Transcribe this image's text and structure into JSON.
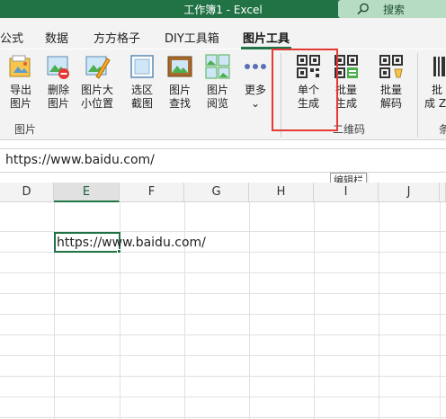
{
  "titlebar": {
    "title": "工作簿1  -  Excel",
    "search_label": "搜索"
  },
  "tabs": [
    {
      "label": "公式"
    },
    {
      "label": "数据"
    },
    {
      "label": "方方格子"
    },
    {
      "label": "DIY工具箱"
    },
    {
      "label": "图片工具",
      "active": true
    }
  ],
  "ribbon": {
    "picture_group": {
      "label": "图片",
      "buttons": [
        {
          "line1": "导出",
          "line2": "图片"
        },
        {
          "line1": "删除",
          "line2": "图片"
        },
        {
          "line1": "图片大",
          "line2": "小位置"
        },
        {
          "line1": "选区",
          "line2": "截图"
        },
        {
          "line1": "图片",
          "line2": "查找"
        },
        {
          "line1": "图片",
          "line2": "阅览"
        },
        {
          "line1": "更多",
          "line2": "⌄"
        }
      ]
    },
    "qr_group": {
      "label": "二维码",
      "buttons": [
        {
          "line1": "单个",
          "line2": "生成"
        },
        {
          "line1": "批量",
          "line2": "生成"
        },
        {
          "line1": "批量",
          "line2": "解码"
        }
      ]
    },
    "next_group": {
      "line1": "批",
      "line2": "成 Z",
      "label": "条"
    }
  },
  "formula_bar": {
    "value": "https://www.baidu.com/"
  },
  "tooltip": "编辑栏",
  "columns": [
    "D",
    "E",
    "F",
    "G",
    "H",
    "I",
    "J"
  ],
  "selected_column": "E",
  "active_cell": {
    "ref": "E",
    "value": "https://www.baidu.com/"
  },
  "colors": {
    "excel_green": "#217346",
    "highlight_red": "#e53935"
  }
}
